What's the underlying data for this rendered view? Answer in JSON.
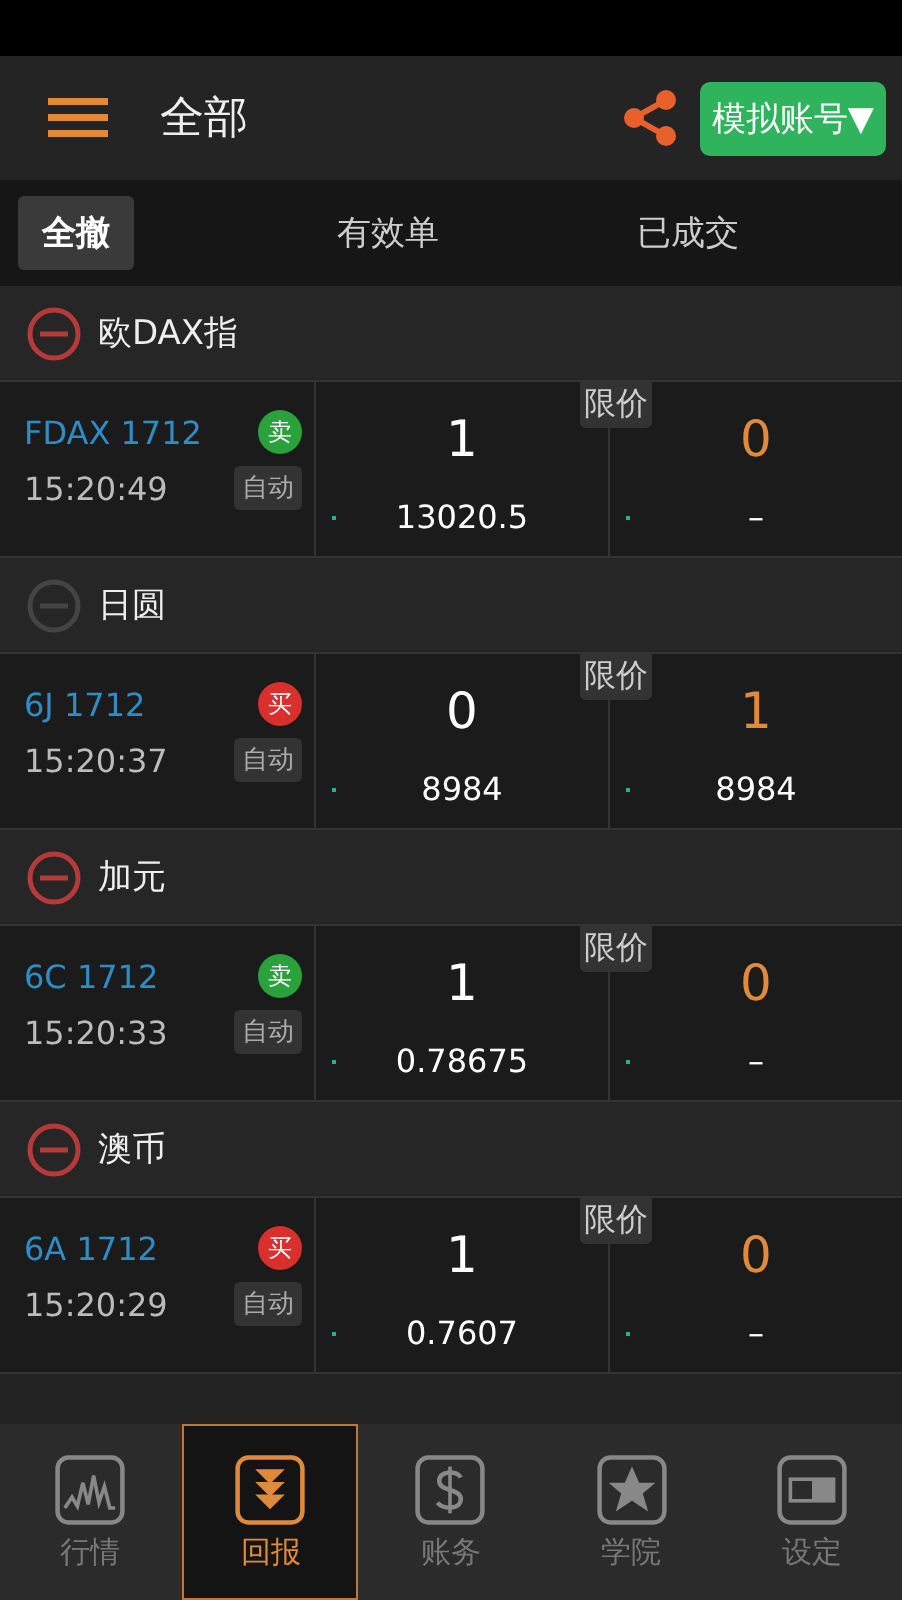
{
  "header": {
    "title": "全部",
    "account_button": "模拟账号▼"
  },
  "toolbar": {
    "cancel_all": "全撤",
    "columns": [
      "有效单",
      "已成交"
    ]
  },
  "groups": [
    {
      "name": "欧DAX指",
      "cancellable": true,
      "order": {
        "symbol": "FDAX 1712",
        "side": {
          "label": "卖",
          "kind": "sell"
        },
        "time": "15:20:49",
        "mode": "自动",
        "order_qty": "1",
        "order_price": "13020.5",
        "price_type": "限价",
        "filled_qty": "0",
        "filled_price": "–"
      }
    },
    {
      "name": "日圆",
      "cancellable": false,
      "order": {
        "symbol": "6J 1712",
        "side": {
          "label": "买",
          "kind": "buy"
        },
        "time": "15:20:37",
        "mode": "自动",
        "order_qty": "0",
        "order_price": "8984",
        "price_type": "限价",
        "filled_qty": "1",
        "filled_price": "8984"
      }
    },
    {
      "name": "加元",
      "cancellable": true,
      "order": {
        "symbol": "6C 1712",
        "side": {
          "label": "卖",
          "kind": "sell"
        },
        "time": "15:20:33",
        "mode": "自动",
        "order_qty": "1",
        "order_price": "0.78675",
        "price_type": "限价",
        "filled_qty": "0",
        "filled_price": "–"
      }
    },
    {
      "name": "澳币",
      "cancellable": true,
      "order": {
        "symbol": "6A 1712",
        "side": {
          "label": "买",
          "kind": "buy"
        },
        "time": "15:20:29",
        "mode": "自动",
        "order_qty": "1",
        "order_price": "0.7607",
        "price_type": "限价",
        "filled_qty": "0",
        "filled_price": "–"
      }
    }
  ],
  "tabbar": [
    {
      "label": "行情",
      "kind": "quotes",
      "selected": false
    },
    {
      "label": "回报",
      "kind": "reports",
      "selected": true
    },
    {
      "label": "账务",
      "kind": "account",
      "selected": false
    },
    {
      "label": "学院",
      "kind": "academy",
      "selected": false
    },
    {
      "label": "设定",
      "kind": "settings",
      "selected": false
    }
  ]
}
